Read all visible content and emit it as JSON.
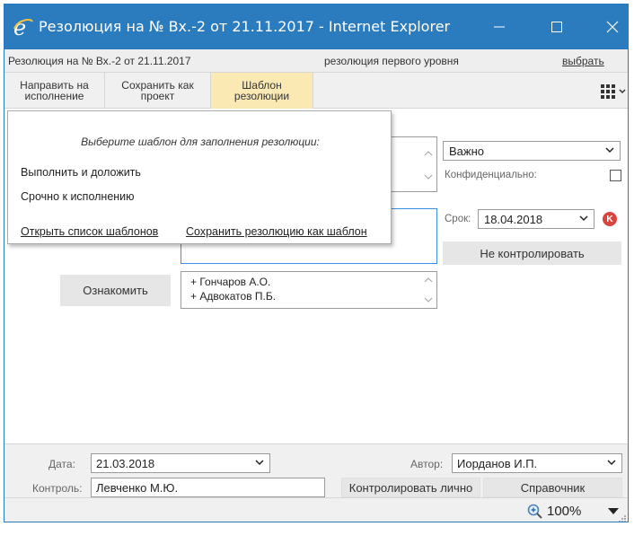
{
  "window": {
    "title": "Резолюция на № Вх.-2 от 21.11.2017 - Internet Explorer"
  },
  "subheader": {
    "document": "Резолюция на № Вх.-2 от 21.11.2017",
    "level": "резолюция первого уровня",
    "choose_link": "выбрать"
  },
  "toolbar": {
    "send_label": "Направить на\nисполнение",
    "save_project_label": "Сохранить как\nпроект",
    "template_label": "Шаблон\nрезолюции"
  },
  "right_panel": {
    "priority": "Важно",
    "confidential_label": "Конфиденциально:",
    "deadline_label": "Срок:",
    "deadline_value": "18.04.2018",
    "no_control_label": "Не контролировать"
  },
  "main": {
    "acquaint_label": "Ознакомить",
    "acquaint_list": [
      "+ Гончаров А.О.",
      "+ Адвокатов П.Б."
    ]
  },
  "template_popup": {
    "hint": "Выберите шаблон для заполнения резолюции:",
    "templates": [
      "Выполнить и доложить",
      "Срочно к исполнению"
    ],
    "open_list_link": "Открыть список шаблонов",
    "save_as_template_link": "Сохранить резолюцию как шаблон"
  },
  "footer": {
    "date_label": "Дата:",
    "date_value": "21.03.2018",
    "author_label": "Автор:",
    "author_value": "Иорданов И.П.",
    "control_label": "Контроль:",
    "control_value": "Левченко М.Ю.",
    "control_personally_label": "Контролировать лично",
    "reference_label": "Справочник"
  },
  "statusbar": {
    "zoom": "100%"
  },
  "colors": {
    "titlebar": "#2b7bbf",
    "active_tab": "#fbe9b4",
    "focus_border": "#3a8ee6",
    "clear_badge": "#d9453c"
  }
}
